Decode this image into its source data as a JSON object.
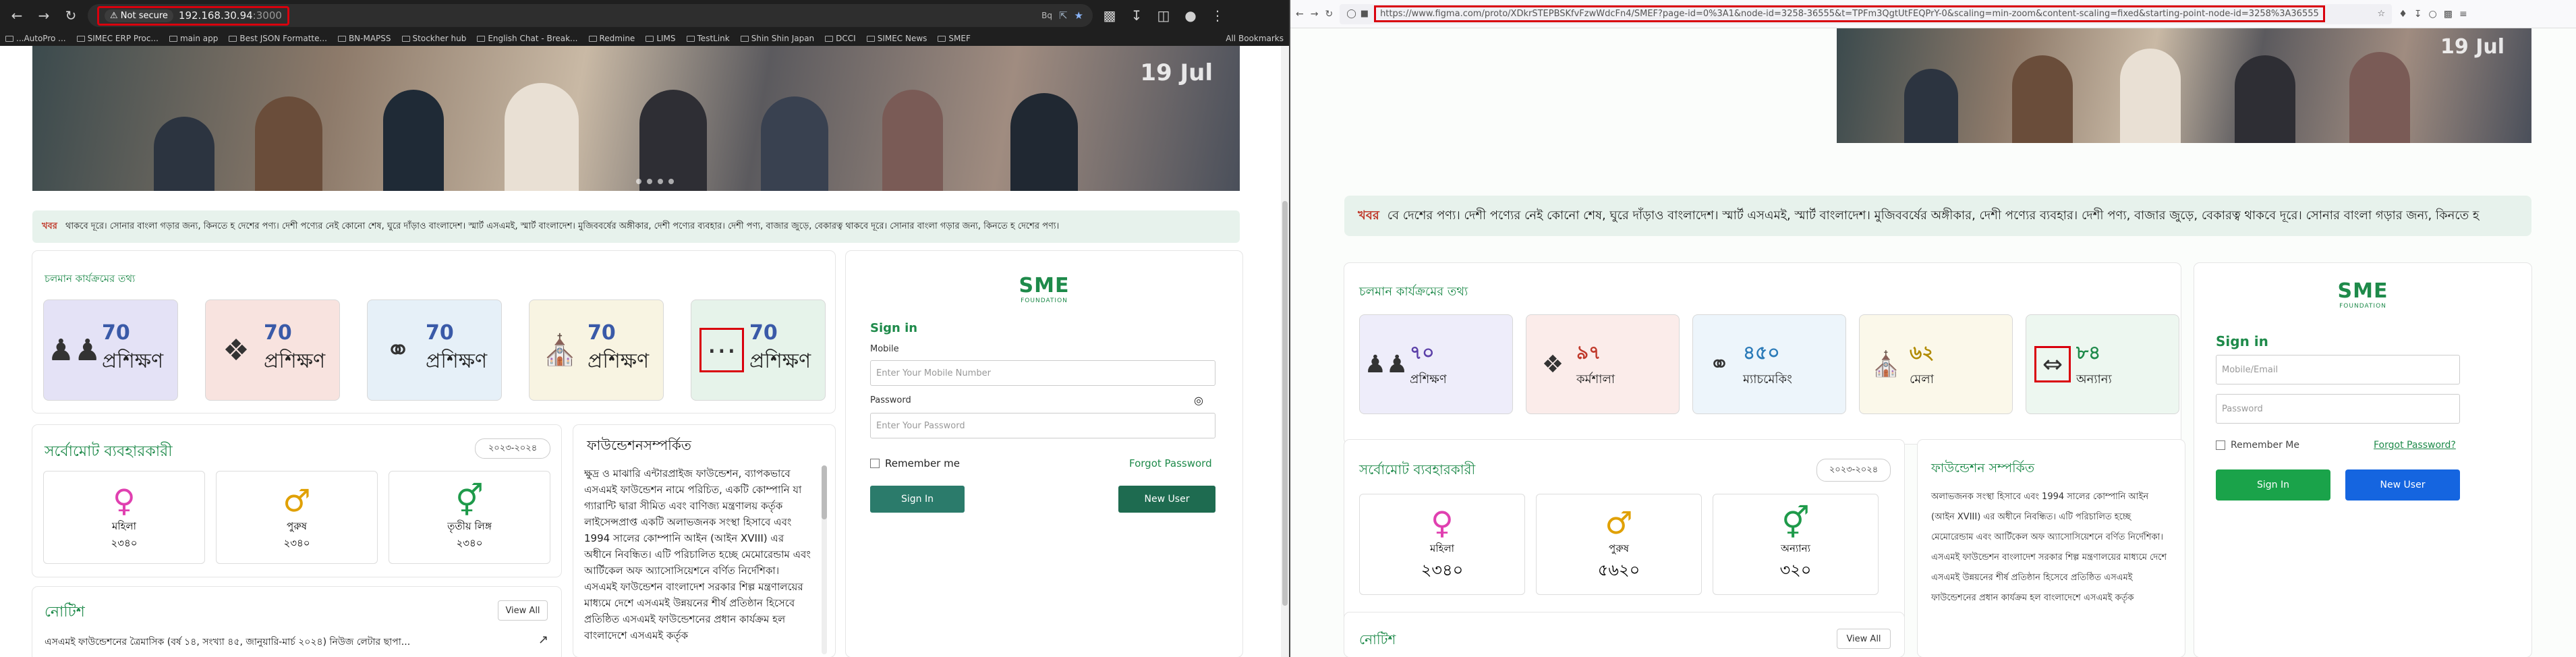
{
  "left_browser": {
    "security_label": "Not secure",
    "address": "192.168.30.94",
    "address_port": ":3000",
    "toolbar_badge": "Bq",
    "bookmarks": [
      "...AutoPro ...",
      "SIMEC ERP Proc...",
      "main app",
      "Best JSON Formatte...",
      "BN-MAPSS",
      "Stockher hub",
      "English Chat - Break...",
      "Redmine",
      "LIMS",
      "TestLink",
      "Shin Shin Japan",
      "DCCI",
      "SIMEC News",
      "SMEF"
    ],
    "all_bookmarks": "All Bookmarks"
  },
  "left_page": {
    "banner_text": "19 Jul",
    "news_label": "খবর",
    "news_text": "থাকবে দূরে। সোনার বাংলা গড়ার জন্য, কিনতে হ দেশের পণ্য। দেশী পণ্যের নেই কোনো শেষ, ঘুরে দাঁড়াও বাংলাদেশ। স্মার্ট এসএমই, স্মার্ট বাংলাদেশ। মুজিববর্ষের অঙ্গীকার, দেশী পণ্যের ব্যবহার। দেশী পণ্য, বাজার জুড়ে, বেকারত্ব থাকবে দূরে। সোনার বাংলা গড়ার জন্য, কিনতে হ দেশের পণ্য।",
    "programs_title": "চলমান কার্যক্রমের তথ্য",
    "programs": [
      {
        "num": "70",
        "label": "প্রশিক্ষণ",
        "icon": "training-group-icon",
        "bg": "#e4e2f6"
      },
      {
        "num": "70",
        "label": "প্রশিক্ষণ",
        "icon": "workshop-icon",
        "bg": "#f8e3df"
      },
      {
        "num": "70",
        "label": "প্রশিক্ষণ",
        "icon": "matchmaking-icon",
        "bg": "#e6f0f8"
      },
      {
        "num": "70",
        "label": "প্রশিক্ষণ",
        "icon": "fair-stall-icon",
        "bg": "#f8f4e2"
      },
      {
        "num": "70",
        "label": "প্রশিক্ষণ",
        "icon": "more-dots-icon",
        "bg": "#e6f3ea"
      }
    ],
    "users_title": "সর্বোমোট ব্যবহারকারী",
    "users_year": "২০২৩-২০২৪",
    "genders": [
      {
        "label": "মহিলা",
        "value": "২৩৪০",
        "icon": "female-icon",
        "color": "#e040b0"
      },
      {
        "label": "পুরুষ",
        "value": "২৩৪০",
        "icon": "male-icon",
        "color": "#e0a000"
      },
      {
        "label": "তৃতীয় লিঙ্গ",
        "value": "২৩৪০",
        "icon": "third-gender-icon",
        "color": "#1e9a4a"
      }
    ],
    "about_title": "ফাউন্ডেশনসম্পর্কিত",
    "about_text": "ক্ষুদ্র ও মাঝারি এন্টারপ্রাইজ ফাউন্ডেশন, ব্যাপকভাবে এসএমই ফাউন্ডেশন নামে পরিচিত, একটি কোম্পানি যা গ্যারান্টি দ্বারা সীমিত এবং বাণিজ্য মন্ত্রণালয় কর্তৃক লাইসেন্সপ্রাপ্ত একটি অলাভজনক সংস্থা হিসাবে এবং 1994 সালের কোম্পানি আইন (আইন XVIII) এর অধীনে নিবন্ধিত। এটি পরিচালিত হচ্ছে মেমোরেন্ডাম এবং আর্টিকেল অফ অ্যাসোসিয়েশনে বর্ণিত নির্দেশিকা। এসএমই ফাউন্ডেশন বাংলাদেশ সরকার শিল্প মন্ত্রণালয়ের মাধ্যমে দেশে এসএমই উন্নয়নের শীর্ষ প্রতিষ্ঠান হিসেবে প্রতিষ্ঠিত এসএমই ফাউন্ডেশনের প্রধান কার্যক্রম হল বাংলাদেশে এসএমই কর্তৃক",
    "notice_title": "নোটিশ",
    "view_all": "View All",
    "notice_item": "এসএমই ফাউন্ডেশনের ত্রৈমাসিক (বর্ষ ১৪, সংখ্যা ৪৫, জানুয়ারি-মার্চ ২০২৪) নিউজ লেটার ছাপা...",
    "logo_big": "SME",
    "logo_small": "FOUNDATION",
    "signin_title": "Sign in",
    "mobile_label": "Mobile",
    "mobile_placeholder": "Enter Your Mobile Number",
    "password_label": "Password",
    "password_placeholder": "Enter Your Password",
    "remember": "Remember me",
    "forgot": "Forgot Password",
    "signin_btn": "Sign In",
    "newuser_btn": "New User"
  },
  "right_browser": {
    "url": "https://www.figma.com/proto/XDkrSTEPBSKfvFzwWdcFn4/SMEF?page-id=0%3A1&node-id=3258-36555&t=TPFm3QgtUtFEQPrY-0&scaling=min-zoom&content-scaling=fixed&starting-point-node-id=3258%3A36555"
  },
  "right_page": {
    "news_label": "খবর",
    "news_text": "বে দেশের পণ্য। দেশী পণ্যের নেই কোনো শেষ, ঘুরে দাঁড়াও বাংলাদেশ। স্মার্ট এসএমই, স্মার্ট বাংলাদেশ। মুজিববর্ষের অঙ্গীকার, দেশী পণ্যের ব্যবহার। দেশী পণ্য, বাজার জুড়ে, বেকারত্ব থাকবে দূরে। সোনার বাংলা গড়ার জন্য, কিনতে হ",
    "banner_text": "19 Jul",
    "programs_title": "চলমান কার্যক্রমের তথ্য",
    "programs": [
      {
        "num": "৭০",
        "label": "প্রশিক্ষণ",
        "icon": "training-group-icon",
        "bg": "#eeedfa",
        "color": "#5b3fa8"
      },
      {
        "num": "৯৭",
        "label": "কর্মশালা",
        "icon": "workshop-icon",
        "bg": "#fbecea",
        "color": "#c0392b"
      },
      {
        "num": "৪৫০",
        "label": "ম্যাচমেকিং",
        "icon": "matchmaking-icon",
        "bg": "#edf5fb",
        "color": "#2a7ab8"
      },
      {
        "num": "৬২",
        "label": "মেলা",
        "icon": "fair-stall-icon",
        "bg": "#fbf8ea",
        "color": "#b08a00"
      },
      {
        "num": "৮৪",
        "label": "অন্যান্য",
        "icon": "resize-arrows-icon",
        "bg": "#edf7f0",
        "color": "#1e8a4a"
      }
    ],
    "users_title": "সর্বোমোট ব্যবহারকারী",
    "users_year": "২০২৩-২০২৪",
    "genders": [
      {
        "label": "মহিলা",
        "value": "২৩৪০",
        "icon": "female-icon",
        "color": "#e040b0"
      },
      {
        "label": "পুরুষ",
        "value": "৫৬২০",
        "icon": "male-icon",
        "color": "#e0a000"
      },
      {
        "label": "অন্যান্য",
        "value": "৩২০",
        "icon": "third-gender-icon",
        "color": "#1e9a4a"
      }
    ],
    "about_title": "ফাউন্ডেশন সম্পর্কিত",
    "about_text": "অলাভজনক সংস্থা হিসাবে এবং 1994 সালের কোম্পানি আইন (আইন XVIII) এর অধীনে নিবন্ধিত। এটি পরিচালিত হচ্ছে মেমোরেন্ডাম এবং আর্টিকেল অফ অ্যাসোসিয়েশনে বর্ণিত নির্দেশিকা। এসএমই ফাউন্ডেশন বাংলাদেশ সরকার শিল্প মন্ত্রণালয়ের মাধ্যমে দেশে এসএমই উন্নয়নের শীর্ষ প্রতিষ্ঠান হিসেবে প্রতিষ্ঠিত এসএমই ফাউন্ডেশনের প্রধান কার্যক্রম হল বাংলাদেশে এসএমই কর্তৃক",
    "notice_title": "নোটিশ",
    "view_all": "View All",
    "logo_big": "SME",
    "logo_small": "FOUNDATION",
    "signin_title": "Sign in",
    "mobile_placeholder": "Mobile/Email",
    "password_placeholder": "Password",
    "remember": "Remember Me",
    "forgot": "Forgot Password?",
    "signin_btn": "Sign In",
    "newuser_btn": "New User"
  }
}
